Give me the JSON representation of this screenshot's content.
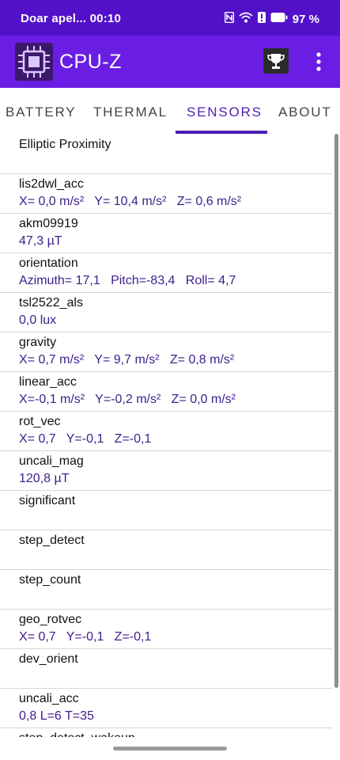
{
  "status": {
    "carrier_time": "Doar apel...  00:10",
    "battery": "97 %",
    "icons": [
      "nfc-icon",
      "wifi-icon",
      "alert-icon",
      "battery-icon"
    ]
  },
  "app_bar": {
    "title": "CPU-Z",
    "icons": [
      "cpu-chip-icon",
      "trophy-icon",
      "overflow-menu-icon"
    ],
    "colors": {
      "status": "#5211c9",
      "bar": "#6a1ee4",
      "accent": "#4b1fb0"
    }
  },
  "tabs": [
    {
      "label": "BATTERY"
    },
    {
      "label": "THERMAL"
    },
    {
      "label": "SENSORS",
      "active": true
    },
    {
      "label": "ABOUT"
    }
  ],
  "sensors": [
    {
      "name": "Elliptic Proximity",
      "value": ""
    },
    {
      "name": "lis2dwl_acc",
      "value": "X= 0,0 m/s²   Y= 10,4 m/s²   Z= 0,6 m/s²"
    },
    {
      "name": "akm09919",
      "value": "47,3 µT"
    },
    {
      "name": "orientation",
      "value": "Azimuth= 17,1   Pitch=-83,4   Roll= 4,7"
    },
    {
      "name": "tsl2522_als",
      "value": "0,0 lux"
    },
    {
      "name": "gravity",
      "value": "X= 0,7 m/s²   Y= 9,7 m/s²   Z= 0,8 m/s²"
    },
    {
      "name": "linear_acc",
      "value": "X=-0,1 m/s²   Y=-0,2 m/s²   Z= 0,0 m/s²"
    },
    {
      "name": "rot_vec",
      "value": "X= 0,7   Y=-0,1   Z=-0,1"
    },
    {
      "name": "uncali_mag",
      "value": "120,8 µT"
    },
    {
      "name": "significant",
      "value": ""
    },
    {
      "name": "step_detect",
      "value": ""
    },
    {
      "name": "step_count",
      "value": ""
    },
    {
      "name": "geo_rotvec",
      "value": "X= 0,7   Y=-0,1   Z=-0,1"
    },
    {
      "name": "dev_orient",
      "value": ""
    },
    {
      "name": "uncali_acc",
      "value": "0,8 L=6 T=35"
    },
    {
      "name": "step_detect_wakeup",
      "value": ""
    }
  ]
}
